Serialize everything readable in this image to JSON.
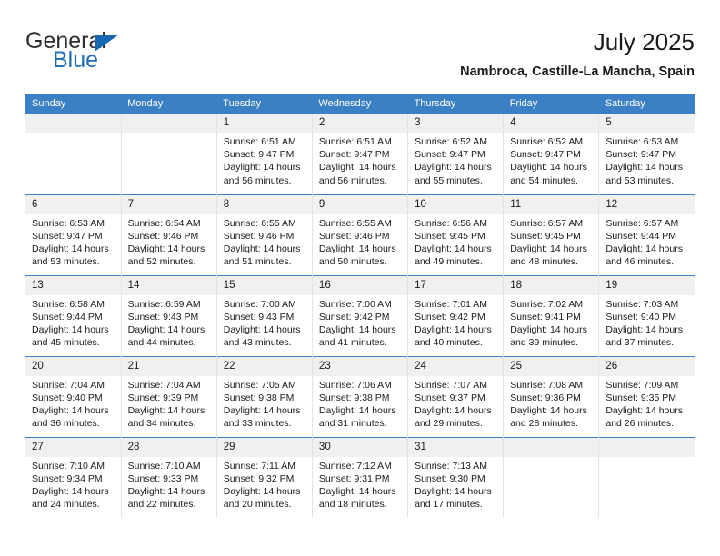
{
  "logo": {
    "word1": "General",
    "word2": "Blue",
    "triangle_icon": "triangle-icon",
    "color_general": "#2e2e2e",
    "color_blue": "#1f6cb5"
  },
  "header": {
    "title": "July 2025",
    "subtitle": "Nambroca, Castille-La Mancha, Spain"
  },
  "theme": {
    "header_bg": "#3b7fc4",
    "header_text": "#ffffff",
    "daynum_bg": "#f0f0f0",
    "grid_line": "#e3e3e3",
    "week_rule": "#3b7fc4"
  },
  "calendar": {
    "weekday_headers": [
      "Sunday",
      "Monday",
      "Tuesday",
      "Wednesday",
      "Thursday",
      "Friday",
      "Saturday"
    ],
    "weeks": [
      [
        {
          "day": "",
          "lines": []
        },
        {
          "day": "",
          "lines": []
        },
        {
          "day": "1",
          "lines": [
            "Sunrise: 6:51 AM",
            "Sunset: 9:47 PM",
            "Daylight: 14 hours",
            "and 56 minutes."
          ]
        },
        {
          "day": "2",
          "lines": [
            "Sunrise: 6:51 AM",
            "Sunset: 9:47 PM",
            "Daylight: 14 hours",
            "and 56 minutes."
          ]
        },
        {
          "day": "3",
          "lines": [
            "Sunrise: 6:52 AM",
            "Sunset: 9:47 PM",
            "Daylight: 14 hours",
            "and 55 minutes."
          ]
        },
        {
          "day": "4",
          "lines": [
            "Sunrise: 6:52 AM",
            "Sunset: 9:47 PM",
            "Daylight: 14 hours",
            "and 54 minutes."
          ]
        },
        {
          "day": "5",
          "lines": [
            "Sunrise: 6:53 AM",
            "Sunset: 9:47 PM",
            "Daylight: 14 hours",
            "and 53 minutes."
          ]
        }
      ],
      [
        {
          "day": "6",
          "lines": [
            "Sunrise: 6:53 AM",
            "Sunset: 9:47 PM",
            "Daylight: 14 hours",
            "and 53 minutes."
          ]
        },
        {
          "day": "7",
          "lines": [
            "Sunrise: 6:54 AM",
            "Sunset: 9:46 PM",
            "Daylight: 14 hours",
            "and 52 minutes."
          ]
        },
        {
          "day": "8",
          "lines": [
            "Sunrise: 6:55 AM",
            "Sunset: 9:46 PM",
            "Daylight: 14 hours",
            "and 51 minutes."
          ]
        },
        {
          "day": "9",
          "lines": [
            "Sunrise: 6:55 AM",
            "Sunset: 9:46 PM",
            "Daylight: 14 hours",
            "and 50 minutes."
          ]
        },
        {
          "day": "10",
          "lines": [
            "Sunrise: 6:56 AM",
            "Sunset: 9:45 PM",
            "Daylight: 14 hours",
            "and 49 minutes."
          ]
        },
        {
          "day": "11",
          "lines": [
            "Sunrise: 6:57 AM",
            "Sunset: 9:45 PM",
            "Daylight: 14 hours",
            "and 48 minutes."
          ]
        },
        {
          "day": "12",
          "lines": [
            "Sunrise: 6:57 AM",
            "Sunset: 9:44 PM",
            "Daylight: 14 hours",
            "and 46 minutes."
          ]
        }
      ],
      [
        {
          "day": "13",
          "lines": [
            "Sunrise: 6:58 AM",
            "Sunset: 9:44 PM",
            "Daylight: 14 hours",
            "and 45 minutes."
          ]
        },
        {
          "day": "14",
          "lines": [
            "Sunrise: 6:59 AM",
            "Sunset: 9:43 PM",
            "Daylight: 14 hours",
            "and 44 minutes."
          ]
        },
        {
          "day": "15",
          "lines": [
            "Sunrise: 7:00 AM",
            "Sunset: 9:43 PM",
            "Daylight: 14 hours",
            "and 43 minutes."
          ]
        },
        {
          "day": "16",
          "lines": [
            "Sunrise: 7:00 AM",
            "Sunset: 9:42 PM",
            "Daylight: 14 hours",
            "and 41 minutes."
          ]
        },
        {
          "day": "17",
          "lines": [
            "Sunrise: 7:01 AM",
            "Sunset: 9:42 PM",
            "Daylight: 14 hours",
            "and 40 minutes."
          ]
        },
        {
          "day": "18",
          "lines": [
            "Sunrise: 7:02 AM",
            "Sunset: 9:41 PM",
            "Daylight: 14 hours",
            "and 39 minutes."
          ]
        },
        {
          "day": "19",
          "lines": [
            "Sunrise: 7:03 AM",
            "Sunset: 9:40 PM",
            "Daylight: 14 hours",
            "and 37 minutes."
          ]
        }
      ],
      [
        {
          "day": "20",
          "lines": [
            "Sunrise: 7:04 AM",
            "Sunset: 9:40 PM",
            "Daylight: 14 hours",
            "and 36 minutes."
          ]
        },
        {
          "day": "21",
          "lines": [
            "Sunrise: 7:04 AM",
            "Sunset: 9:39 PM",
            "Daylight: 14 hours",
            "and 34 minutes."
          ]
        },
        {
          "day": "22",
          "lines": [
            "Sunrise: 7:05 AM",
            "Sunset: 9:38 PM",
            "Daylight: 14 hours",
            "and 33 minutes."
          ]
        },
        {
          "day": "23",
          "lines": [
            "Sunrise: 7:06 AM",
            "Sunset: 9:38 PM",
            "Daylight: 14 hours",
            "and 31 minutes."
          ]
        },
        {
          "day": "24",
          "lines": [
            "Sunrise: 7:07 AM",
            "Sunset: 9:37 PM",
            "Daylight: 14 hours",
            "and 29 minutes."
          ]
        },
        {
          "day": "25",
          "lines": [
            "Sunrise: 7:08 AM",
            "Sunset: 9:36 PM",
            "Daylight: 14 hours",
            "and 28 minutes."
          ]
        },
        {
          "day": "26",
          "lines": [
            "Sunrise: 7:09 AM",
            "Sunset: 9:35 PM",
            "Daylight: 14 hours",
            "and 26 minutes."
          ]
        }
      ],
      [
        {
          "day": "27",
          "lines": [
            "Sunrise: 7:10 AM",
            "Sunset: 9:34 PM",
            "Daylight: 14 hours",
            "and 24 minutes."
          ]
        },
        {
          "day": "28",
          "lines": [
            "Sunrise: 7:10 AM",
            "Sunset: 9:33 PM",
            "Daylight: 14 hours",
            "and 22 minutes."
          ]
        },
        {
          "day": "29",
          "lines": [
            "Sunrise: 7:11 AM",
            "Sunset: 9:32 PM",
            "Daylight: 14 hours",
            "and 20 minutes."
          ]
        },
        {
          "day": "30",
          "lines": [
            "Sunrise: 7:12 AM",
            "Sunset: 9:31 PM",
            "Daylight: 14 hours",
            "and 18 minutes."
          ]
        },
        {
          "day": "31",
          "lines": [
            "Sunrise: 7:13 AM",
            "Sunset: 9:30 PM",
            "Daylight: 14 hours",
            "and 17 minutes."
          ]
        },
        {
          "day": "",
          "lines": []
        },
        {
          "day": "",
          "lines": []
        }
      ]
    ]
  }
}
